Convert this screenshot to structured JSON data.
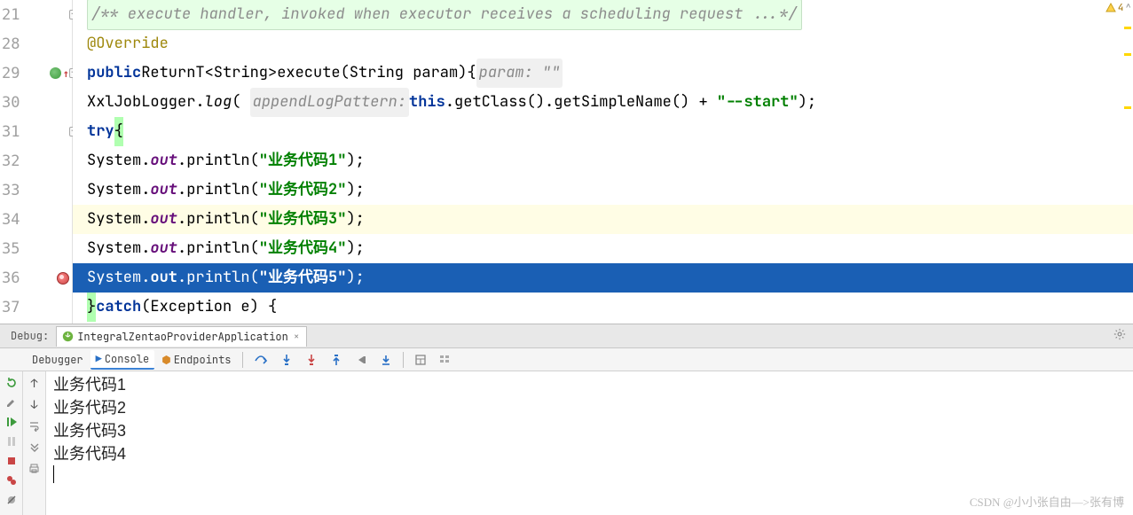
{
  "editor": {
    "lines": [
      {
        "num": 21,
        "type": "doc",
        "text": "/** execute handler, invoked when executor receives a scheduling request ...*/"
      },
      {
        "num": 28,
        "type": "annotation",
        "text": "@Override"
      },
      {
        "num": 29,
        "type": "signature",
        "kw1": "public",
        "ret": "ReturnT<String>",
        "name": "execute",
        "params": "(String param)",
        "brace": "{",
        "hint_label": "param:",
        "hint_val": "\"\""
      },
      {
        "num": 30,
        "type": "logger",
        "cls": "XxlJobLogger",
        "method": "log",
        "hint": "appendLogPattern:",
        "expr_a": "this",
        "expr_b": ".getClass().getSimpleName() + ",
        "str": "\"--start\"",
        "tail": ");"
      },
      {
        "num": 31,
        "type": "try",
        "kw": "try",
        "brace": "{"
      },
      {
        "num": 32,
        "type": "sout",
        "str": "\"业务代码1\""
      },
      {
        "num": 33,
        "type": "sout",
        "str": "\"业务代码2\""
      },
      {
        "num": 34,
        "type": "sout",
        "str": "\"业务代码3\"",
        "yellow": true
      },
      {
        "num": 35,
        "type": "sout",
        "str": "\"业务代码4\""
      },
      {
        "num": 36,
        "type": "sout",
        "str": "\"业务代码5\"",
        "selected": true
      },
      {
        "num": 37,
        "type": "catch",
        "brace": "}",
        "kw": "catch",
        "params": "(Exception e) {"
      }
    ],
    "sout": {
      "cls": "System",
      "fld": "out",
      "method": "println",
      "tail": ");"
    }
  },
  "warnings": {
    "count": "4"
  },
  "gutter": {
    "override_line": 29,
    "breakpoint_line": 36
  },
  "debug": {
    "label": "Debug:",
    "session": "IntegralZentaoProviderApplication",
    "tabs": {
      "debugger": "Debugger",
      "console": "Console",
      "endpoints": "Endpoints"
    },
    "console_output": [
      "业务代码1",
      "业务代码2",
      "业务代码3",
      "业务代码4"
    ]
  },
  "watermark": "CSDN @小小张自由—>张有博"
}
